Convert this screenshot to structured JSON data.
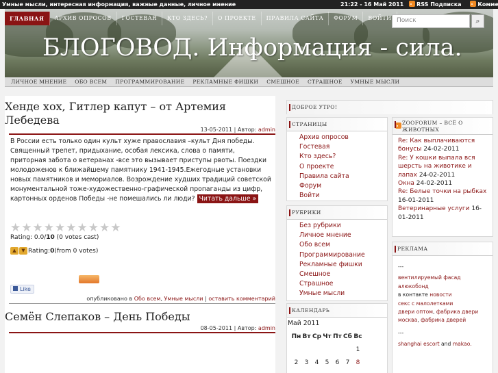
{
  "topbar": {
    "tagline": "Умные мысли, интересная информация, важные данные, личное мнение",
    "datetime": "21:22 - 16 Май 2011",
    "rss_posts": "RSS Подписка",
    "rss_comments": "Комментарии"
  },
  "nav": [
    "ГЛАВНАЯ",
    "АРХИВ ОПРОСОВ",
    "ГОСТЕВАЯ",
    "КТО ЗДЕСЬ?",
    "О ПРОЕКТЕ",
    "ПРАВИЛА САЙТА",
    "ФОРУМ",
    "ВОЙТИ"
  ],
  "search": {
    "placeholder": "Поиск"
  },
  "site_title": "БЛОГОВОД. Информация - сила.",
  "categories": [
    "ЛИЧНОЕ МНЕНИЕ",
    "ОБО ВСЕМ",
    "ПРОГРАММИРОВАНИЕ",
    "РЕКЛАМНЫЕ ФИШКИ",
    "СМЕШНОЕ",
    "СТРАШНОЕ",
    "УМНЫЕ МЫСЛИ"
  ],
  "post1": {
    "title": "Хенде хох, Гитлер капут – от Артемия Лебедева",
    "date": "13-05-2011",
    "author_label": "Автор:",
    "author": "admin",
    "body": "В России есть только один культ хуже православия –культ Дня победы. Священный трепет, придыхание, особая лексика, слова о памяти, приторная забота о ветеранах -все это вызывает приступы рвоты. Поездки молодоженов к ближайшему памятнику 1941-1945.Ежегодные установки новых памятников и мемориалов. Возрождение худших традиций советской монументальной тоже-художественно-графической пропаганды из цифр, картонных орденов Победы -не помешались ли люди?",
    "more": "Читать дальше »",
    "rating_line": "Rating: 0.0/",
    "rating_max": "10",
    "rating_votes": " (0 votes cast)",
    "thumbs_line": "Rating: ",
    "thumbs_value": "0",
    "thumbs_votes": " (from 0 votes)",
    "like": "Like",
    "published": "опубликовано в",
    "cat1": "Обо всем",
    "cat2": "Умные мысли",
    "comment": "оставить комментарий"
  },
  "post2": {
    "title": "Семён Слепаков – День Победы",
    "date": "08-05-2011",
    "author_label": "Автор:",
    "author": "admin"
  },
  "sidebar": {
    "greeting": "ДОБРОЕ УТРО!",
    "pages_head": "СТРАНИЦЫ",
    "pages": [
      "Архив опросов",
      "Гостевая",
      "Кто здесь?",
      "О проекте",
      "Правила сайта",
      "Форум",
      "Войти"
    ],
    "rubrics_head": "РУБРИКИ",
    "rubrics": [
      "Без рубрики",
      "Личное мнение",
      "Обо всем",
      "Программирование",
      "Рекламные фишки",
      "Смешное",
      "Страшное",
      "Умные мысли"
    ],
    "calendar_head": "КАЛЕНДАРЬ",
    "calendar_month": "Май 2011",
    "calendar_days": [
      "Пн",
      "Вт",
      "Ср",
      "Чт",
      "Пт",
      "Сб",
      "Вс"
    ],
    "calendar_row1": [
      "",
      "",
      "",
      "",
      "",
      "",
      "1"
    ],
    "calendar_row2": [
      "2",
      "3",
      "4",
      "5",
      "6",
      "7",
      "8"
    ],
    "zoo_head": "ZOOFORUM – ВСЁ О ЖИВОТНЫХ",
    "zoo_items": [
      {
        "link": "Re: Как выплачиваются бонусы",
        "date": " 24-02-2011"
      },
      {
        "link": "Re: У кошки выпала вся шерсть на животике и лапах",
        "date": " 24-02-2011"
      },
      {
        "link": "Окна",
        "date": " 24-02-2011"
      },
      {
        "link": "Re: Белые точки на рыбках",
        "date": " 16-01-2011"
      },
      {
        "link": "Ветеринарные услуги",
        "date": " 16-01-2011"
      }
    ],
    "ads_head": "РЕКЛАМА",
    "ads": {
      "sep1": "---",
      "l1": "вентилируемый фасад",
      "l2": "алюкобонд",
      "t3": "в контакте ",
      "l3": "новости",
      "l4": "секс с малолетками",
      "l5": "двери оптом",
      "l6": "фабрика двери москва",
      "l7": "фабрика дверей",
      "sep2": "---",
      "l8": "shanghai escort",
      "t8": " and ",
      "l9": "makao."
    }
  }
}
